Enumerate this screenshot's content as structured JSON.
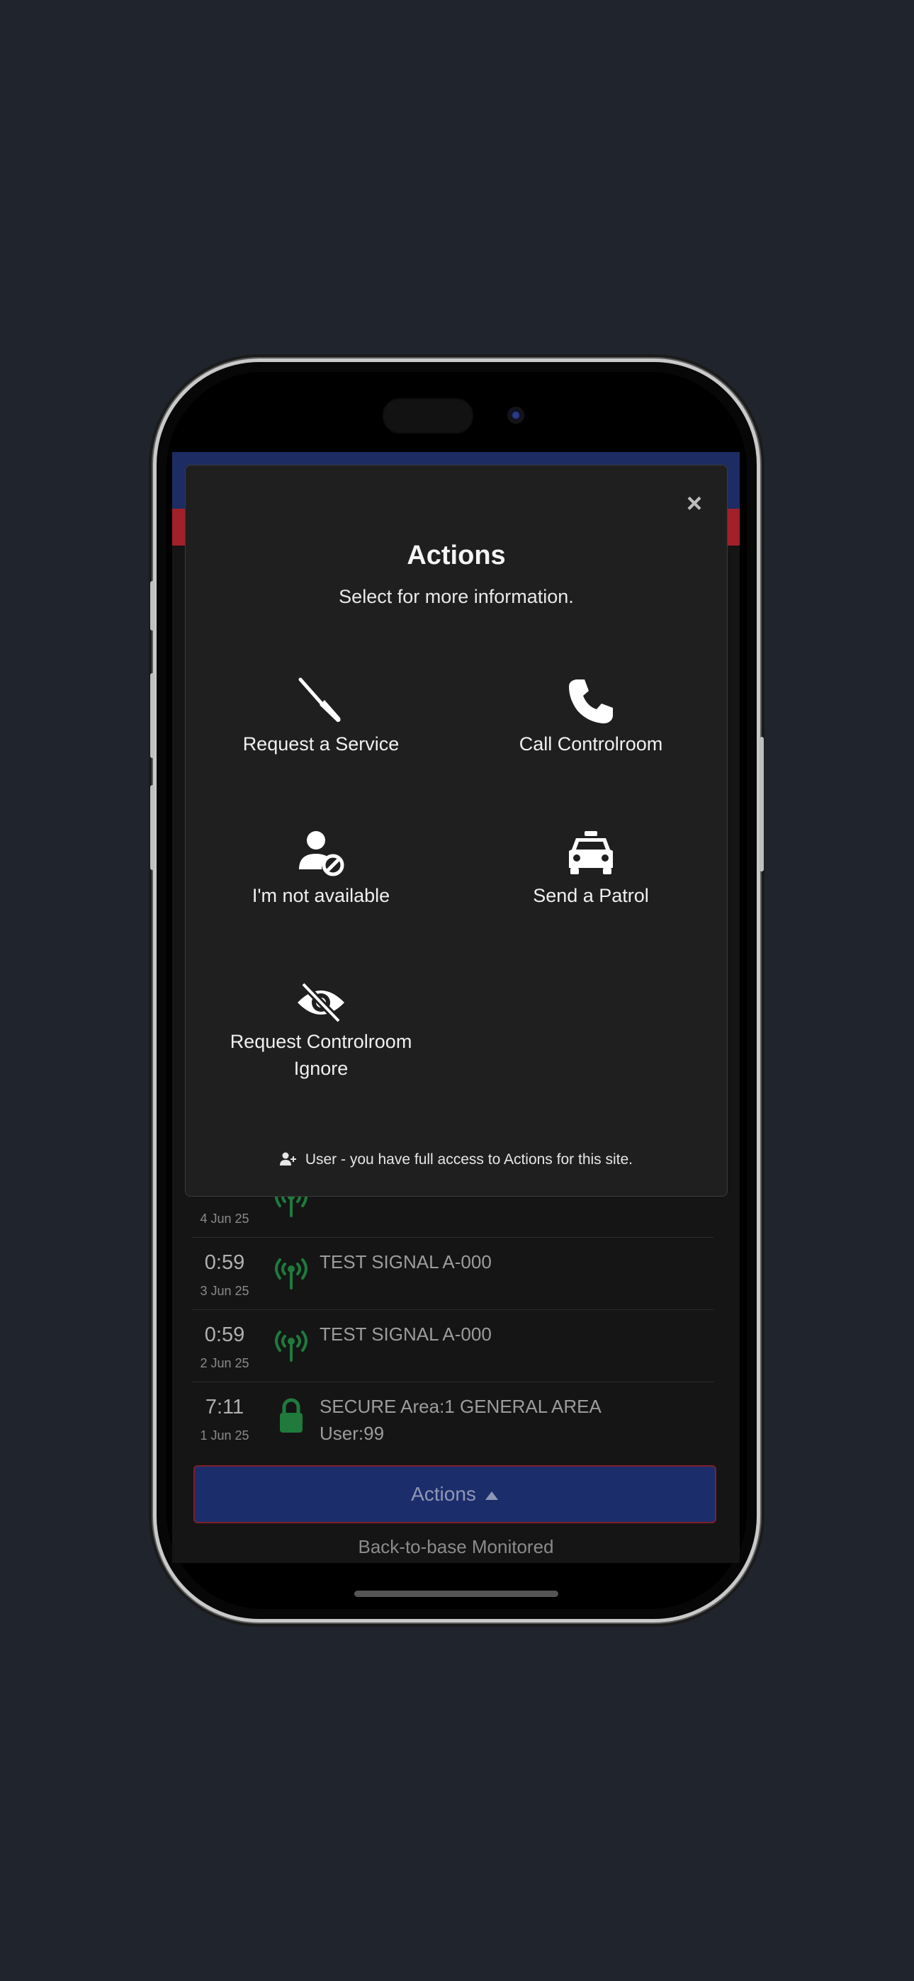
{
  "modal": {
    "title": "Actions",
    "subtitle": "Select for more information.",
    "close_label": "×",
    "options": [
      {
        "label": "Request a Service",
        "icon": "screwdriver-icon"
      },
      {
        "label": "Call Controlroom",
        "icon": "phone-icon"
      },
      {
        "label": "I'm not available",
        "icon": "user-unavailable-icon"
      },
      {
        "label": "Send a Patrol",
        "icon": "car-icon"
      },
      {
        "label": "Request Controlroom Ignore",
        "icon": "eye-slash-icon"
      }
    ],
    "footer": "User - you have full access to Actions for this site."
  },
  "events": [
    {
      "time": "",
      "date": "4 Jun 25",
      "icon": "signal-antenna-icon",
      "text": ""
    },
    {
      "time": "0:59",
      "date": "3 Jun 25",
      "icon": "signal-antenna-icon",
      "text": "TEST SIGNAL A-000"
    },
    {
      "time": "0:59",
      "date": "2 Jun 25",
      "icon": "signal-antenna-icon",
      "text": "TEST SIGNAL A-000"
    },
    {
      "time": "7:11",
      "date": "1 Jun 25",
      "icon": "lock-icon",
      "text": "SECURE Area:1 GENERAL AREA",
      "text2": "User:99"
    }
  ],
  "actions_button": {
    "label": "Actions"
  },
  "status_text": "Back-to-base Monitored",
  "colors": {
    "header_blue": "#1d2c62",
    "header_red": "#a1202a",
    "signal_green": "#1f7a3c",
    "button_blue": "#1c2d6c"
  }
}
